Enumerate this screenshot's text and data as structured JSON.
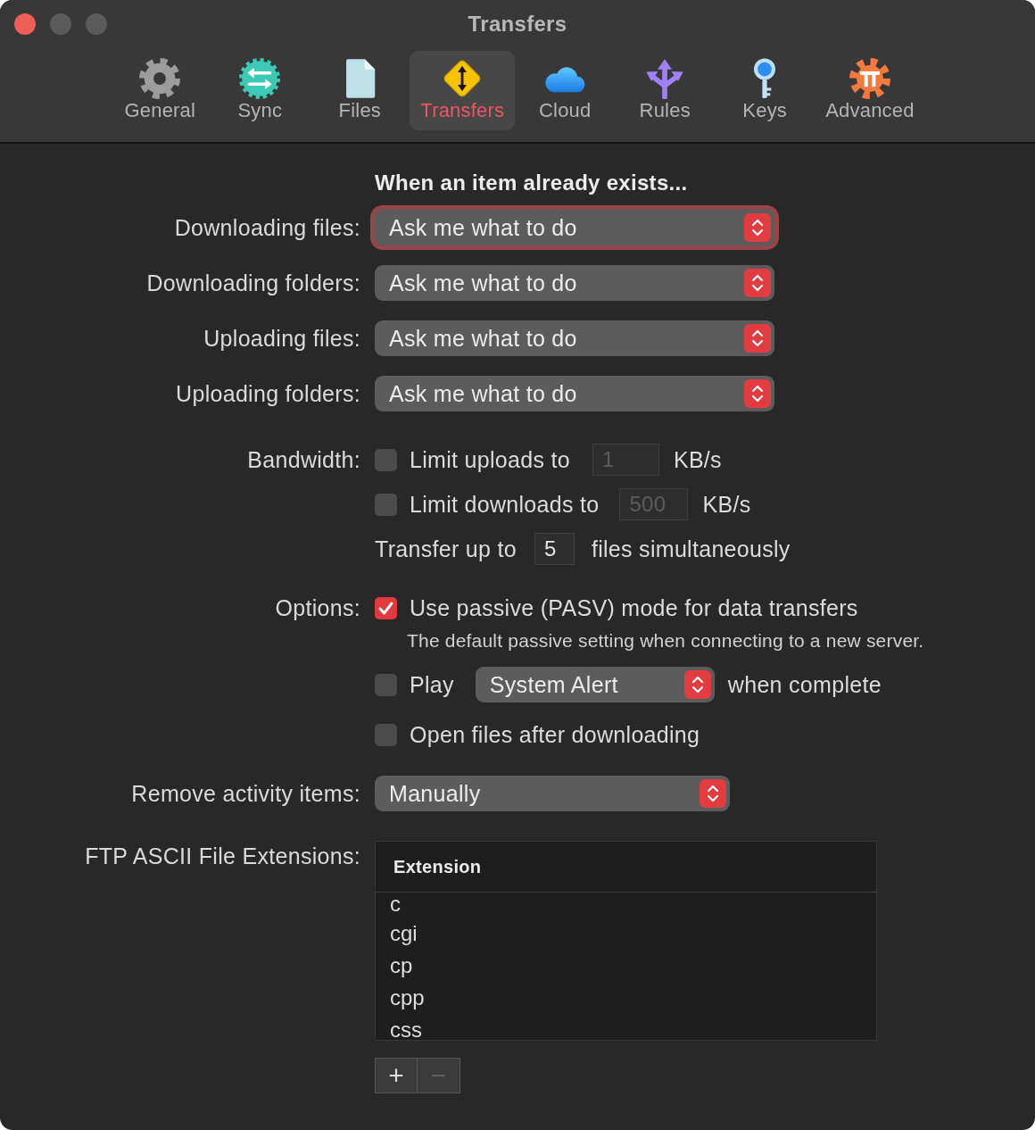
{
  "window": {
    "title": "Transfers"
  },
  "window_controls": [
    {
      "kind": "close",
      "enabled": true
    },
    {
      "kind": "minimize",
      "enabled": false
    },
    {
      "kind": "zoom",
      "enabled": false
    }
  ],
  "toolbar": {
    "tabs": [
      {
        "kind": "general",
        "label": "General",
        "selected": false
      },
      {
        "kind": "sync",
        "label": "Sync",
        "selected": false
      },
      {
        "kind": "files",
        "label": "Files",
        "selected": false
      },
      {
        "kind": "transfers",
        "label": "Transfers",
        "selected": true
      },
      {
        "kind": "cloud",
        "label": "Cloud",
        "selected": false
      },
      {
        "kind": "rules",
        "label": "Rules",
        "selected": false
      },
      {
        "kind": "keys",
        "label": "Keys",
        "selected": false
      },
      {
        "kind": "advanced",
        "label": "Advanced",
        "selected": false
      }
    ]
  },
  "conflicts": {
    "heading": "When an item already exists...",
    "rows": [
      {
        "label": "Downloading files:",
        "value": "Ask me what to do",
        "focused": true
      },
      {
        "label": "Downloading folders:",
        "value": "Ask me what to do",
        "focused": false
      },
      {
        "label": "Uploading files:",
        "value": "Ask me what to do",
        "focused": false
      },
      {
        "label": "Uploading folders:",
        "value": "Ask me what to do",
        "focused": false
      }
    ]
  },
  "bandwidth": {
    "label": "Bandwidth:",
    "limits": [
      {
        "label": "Limit uploads to",
        "checked": false,
        "field": {
          "value": "1",
          "disabled": true
        },
        "unit": "KB/s"
      },
      {
        "label": "Limit downloads to",
        "checked": false,
        "field": {
          "value": "500",
          "disabled": true
        },
        "unit": "KB/s"
      }
    ],
    "simultaneous": {
      "prefix": "Transfer up to",
      "field": {
        "value": "5",
        "disabled": false
      },
      "suffix": "files simultaneously"
    }
  },
  "options": {
    "label": "Options:",
    "passive": {
      "label": "Use passive (PASV) mode for data transfers",
      "checked": true,
      "note": "The default passive setting when connecting to a new server."
    },
    "play": {
      "label": "Play",
      "checked": false,
      "sound": "System Alert",
      "suffix": "when complete"
    },
    "open_after": {
      "label": "Open files after downloading",
      "checked": false
    }
  },
  "remove_activity": {
    "label": "Remove activity items:",
    "value": "Manually"
  },
  "ascii_extensions": {
    "label": "FTP ASCII File Extensions:",
    "table": {
      "columns": [
        "Extension"
      ],
      "rows": [
        [
          "c"
        ],
        [
          "cgi"
        ],
        [
          "cp"
        ],
        [
          "cpp"
        ],
        [
          "css"
        ]
      ]
    },
    "buttons": [
      {
        "label": "+",
        "disabled": false
      },
      {
        "label": "−",
        "disabled": true
      }
    ]
  }
}
